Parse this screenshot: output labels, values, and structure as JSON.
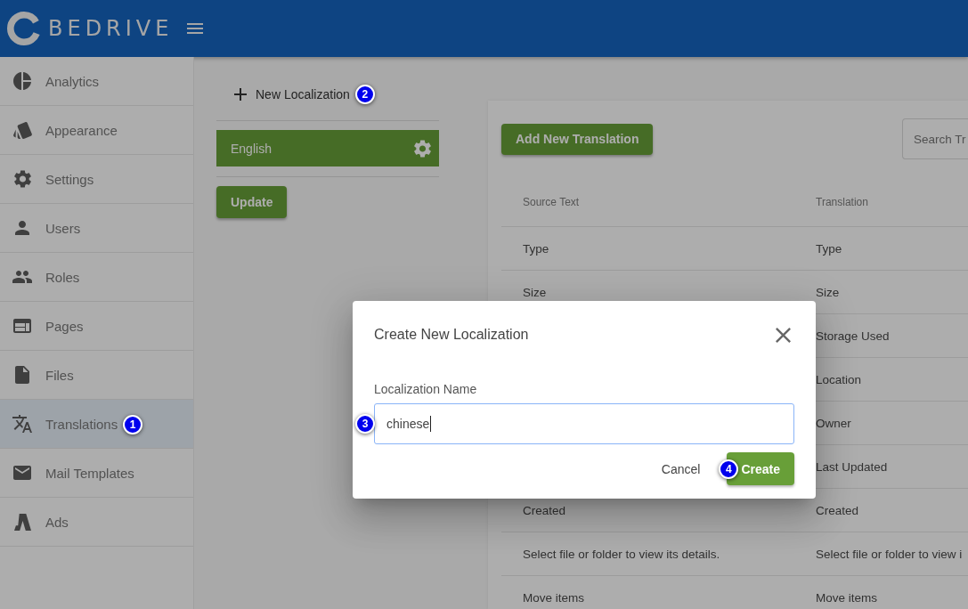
{
  "header": {
    "logo_text": "BEDRIVE"
  },
  "sidebar": {
    "items": [
      {
        "label": "Analytics",
        "selected": false
      },
      {
        "label": "Appearance",
        "selected": false
      },
      {
        "label": "Settings",
        "selected": false
      },
      {
        "label": "Users",
        "selected": false
      },
      {
        "label": "Roles",
        "selected": false
      },
      {
        "label": "Pages",
        "selected": false
      },
      {
        "label": "Files",
        "selected": false
      },
      {
        "label": "Translations",
        "selected": true,
        "marker": "1"
      },
      {
        "label": "Mail Templates",
        "selected": false
      },
      {
        "label": "Ads",
        "selected": false
      }
    ]
  },
  "localizations": {
    "new_button": {
      "label": "New Localization",
      "marker": "2"
    },
    "items": [
      {
        "name": "English",
        "selected": true
      }
    ],
    "update_button": "Update"
  },
  "translations": {
    "add_button": "Add New Translation",
    "search": {
      "placeholder": "Search Tr"
    },
    "columns": [
      "Source Text",
      "Translation"
    ],
    "rows": [
      {
        "source": "Type",
        "translation": "Type"
      },
      {
        "source": "Size",
        "translation": "Size"
      },
      {
        "translation": "Storage Used"
      },
      {
        "translation": "Location"
      },
      {
        "translation": "Owner"
      },
      {
        "translation": "Last Updated"
      },
      {
        "source": "Created",
        "translation": "Created"
      },
      {
        "source": "Select file or folder to view its details.",
        "translation": "Select file or folder to view i"
      },
      {
        "source": "Move items",
        "translation": "Move items"
      }
    ]
  },
  "dialog": {
    "title": "Create New Localization",
    "field": {
      "label": "Localization Name",
      "value": "chinese",
      "focused": true,
      "marker": "3"
    },
    "buttons": [
      {
        "label": "Cancel",
        "kind": "flat"
      },
      {
        "label": "Create",
        "kind": "primary",
        "marker": "4"
      }
    ]
  }
}
